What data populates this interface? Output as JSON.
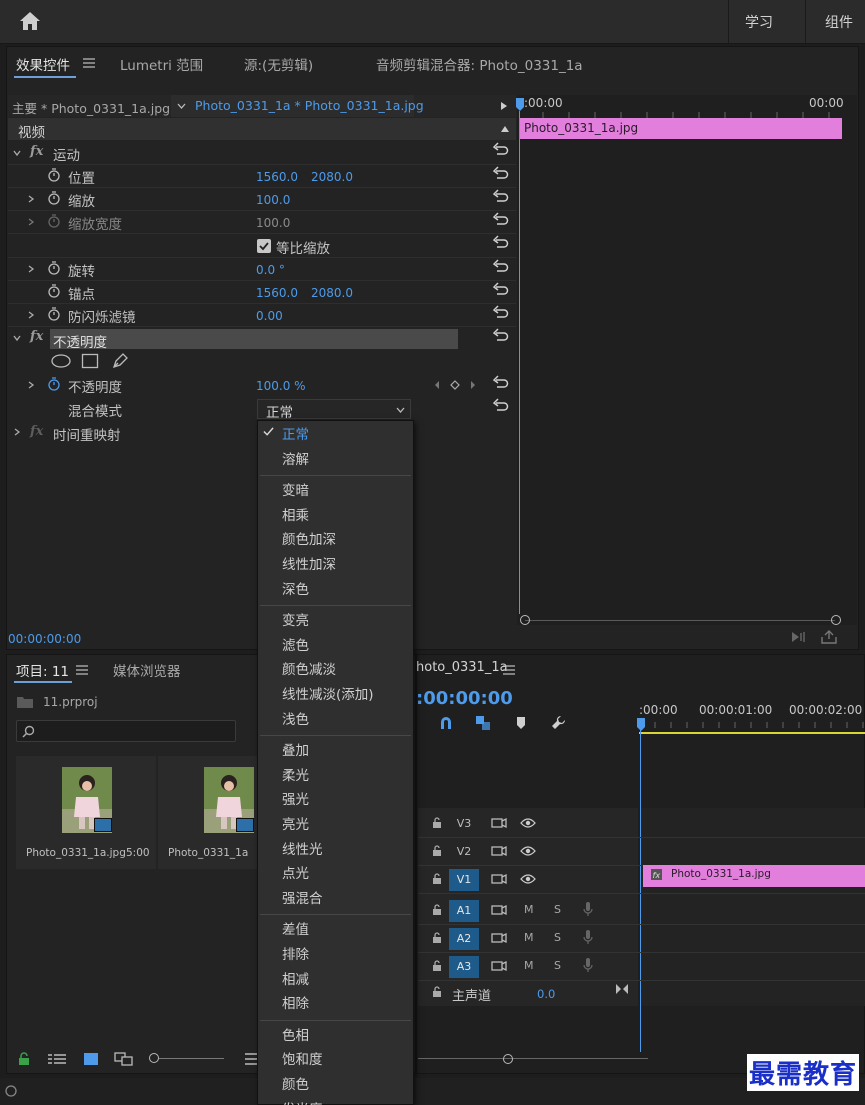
{
  "workspaces": [
    "学习",
    "组件"
  ],
  "effect_panel": {
    "tabs": [
      "效果控件",
      "Lumetri 范围",
      "源:(无剪辑)",
      "音频剪辑混合器: Photo_0331_1a"
    ],
    "master_clip": "主要 * Photo_0331_1a.jpg",
    "sequence_clip": "Photo_0331_1a * Photo_0331_1a.jpg",
    "section_video": "视频",
    "motion": "运动",
    "props": {
      "position": {
        "label": "位置",
        "x": "1560.0",
        "y": "2080.0"
      },
      "scale": {
        "label": "缩放",
        "value": "100.0"
      },
      "scale_width": {
        "label": "缩放宽度",
        "value": "100.0"
      },
      "uniform_scale": "等比缩放",
      "rotation": {
        "label": "旋转",
        "value": "0.0 °"
      },
      "anchor": {
        "label": "锚点",
        "x": "1560.0",
        "y": "2080.0"
      },
      "antiflicker": {
        "label": "防闪烁滤镜",
        "value": "0.00"
      }
    },
    "opacity_section": "不透明度",
    "opacity": {
      "label": "不透明度",
      "value": "100.0 %"
    },
    "blend_mode": {
      "label": "混合模式",
      "value": "正常"
    },
    "time_remap": "时间重映射",
    "timecode": "00:00:00:00",
    "mini_timeline": {
      "start": ":00:00",
      "end": "00:00",
      "clip": "Photo_0331_1a.jpg"
    }
  },
  "blend_menu": {
    "groups": [
      [
        "正常",
        "溶解"
      ],
      [
        "变暗",
        "相乘",
        "颜色加深",
        "线性加深",
        "深色"
      ],
      [
        "变亮",
        "滤色",
        "颜色减淡",
        "线性减淡(添加)",
        "浅色"
      ],
      [
        "叠加",
        "柔光",
        "强光",
        "亮光",
        "线性光",
        "点光",
        "强混合"
      ],
      [
        "差值",
        "排除",
        "相减",
        "相除"
      ],
      [
        "色相",
        "饱和度",
        "颜色",
        "发光度"
      ]
    ],
    "selected": "正常"
  },
  "project_panel": {
    "tabs": [
      "项目: 11",
      "媒体浏览器"
    ],
    "project_file": "11.prproj",
    "search_placeholder": "",
    "items": [
      {
        "name": "Photo_0331_1a.jpg",
        "duration": "5:00"
      },
      {
        "name": "Photo_0331_1a",
        "duration": ""
      }
    ]
  },
  "timeline": {
    "title": "hoto_0331_1a",
    "timecode": ":00:00:00",
    "ruler": [
      ":00:00",
      "00:00:01:00",
      "00:00:02:00"
    ],
    "video_tracks": [
      "V3",
      "V2",
      "V1"
    ],
    "audio_tracks": [
      "A1",
      "A2",
      "A3"
    ],
    "audio_flags": [
      "M",
      "S"
    ],
    "master": {
      "label": "主声道",
      "value": "0.0"
    },
    "clip": "Photo_0331_1a.jpg"
  },
  "watermark": "最需教育",
  "colors": {
    "accent": "#4d9bea",
    "clip": "#e27fdc",
    "track_on": "#1e5b8b"
  }
}
